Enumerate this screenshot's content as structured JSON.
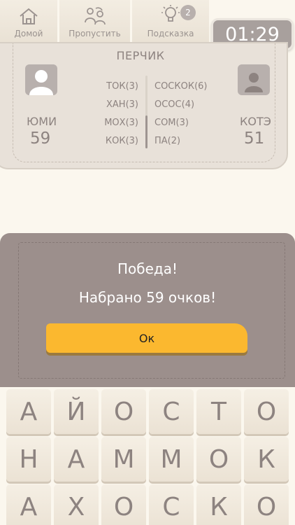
{
  "toolbar": {
    "home_label": "Домой",
    "skip_label": "Пропустить",
    "hint_label": "Подсказка",
    "hint_count": "2",
    "timer": "01:29"
  },
  "board": {
    "word": "ПЕРЧИК",
    "left_player": {
      "name": "ЮМИ",
      "score": "59"
    },
    "right_player": {
      "name": "КОТЭ",
      "score": "51"
    },
    "left_words": [
      "ТОК(3)",
      "ХАН(3)",
      "МОХ(3)",
      "КОК(3)"
    ],
    "right_words": [
      "СОСКОК(6)",
      "ОСОС(4)",
      "СОМ(3)",
      "ПА(2)"
    ]
  },
  "dialog": {
    "line1": "Победа!",
    "line2": "Набрано 59 очков!",
    "ok_label": "Ок"
  },
  "grid": {
    "rows": [
      [
        "А",
        "Й",
        "О",
        "С",
        "Т",
        "О"
      ],
      [
        "Н",
        "А",
        "М",
        "М",
        "О",
        "К"
      ],
      [
        "А",
        "Х",
        "О",
        "С",
        "К",
        "О"
      ]
    ]
  },
  "colors": {
    "background": "#fbf7ee",
    "accent": "#fbb82f",
    "dialog": "#9c8f8c"
  }
}
